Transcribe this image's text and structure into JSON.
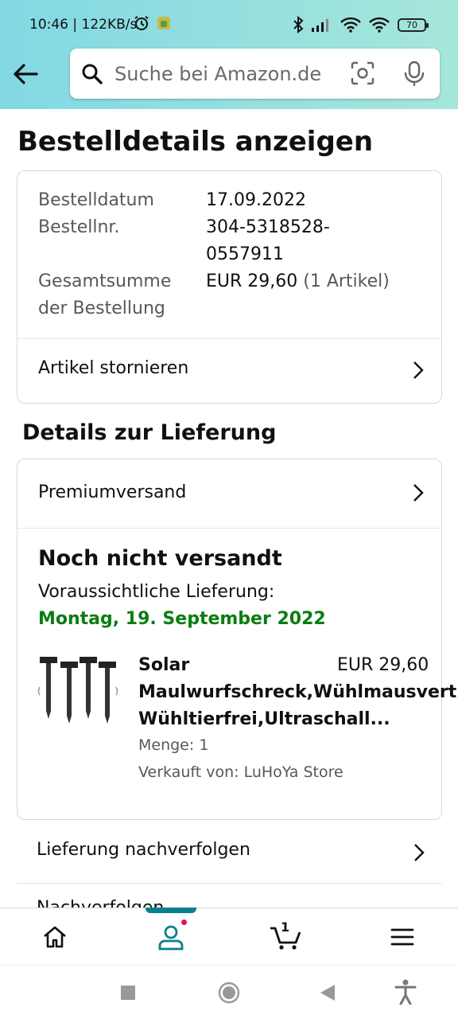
{
  "status_bar": {
    "time_speed": "10:46 | 122KB/s",
    "battery": "70"
  },
  "search": {
    "placeholder": "Suche bei Amazon.de"
  },
  "page": {
    "title": "Bestelldetails anzeigen"
  },
  "order": {
    "date_label": "Bestelldatum",
    "date_value": "17.09.2022",
    "number_label": "Bestellnr.",
    "number_value_1": "304-5318528-",
    "number_value_2": "0557911",
    "total_label_1": "Gesamtsumme",
    "total_label_2": "der Bestellung",
    "total_value": "EUR 29,60",
    "total_items": "(1 Artikel)",
    "cancel_label": "Artikel stornieren"
  },
  "delivery": {
    "section_title": "Details zur Lieferung",
    "shipping_method": "Premiumversand",
    "status": "Noch nicht versandt",
    "estimate_label": "Voraussichtliche Lieferung:",
    "estimate_date": "Montag, 19. September 2022",
    "product": {
      "title_line1": "Solar",
      "title_line2": "Maulwurfschreck,Wühlmausvertreiber",
      "title_line3": "Wühltierfrei,Ultraschall...",
      "price": "EUR 29,60",
      "quantity": "Menge: 1",
      "seller": "Verkauft von: LuHoYa Store"
    },
    "track_label": "Lieferung nachverfolgen",
    "next_row_partial": "Nachverfolgen"
  },
  "bottom_nav": {
    "cart_count": "1"
  },
  "colors": {
    "header_gradient_start": "#82d8e3",
    "header_gradient_end": "#a6e6db",
    "delivery_date_green": "#0a7d12",
    "nav_active": "#0b7f8d",
    "notification_dot": "#e0125d"
  }
}
